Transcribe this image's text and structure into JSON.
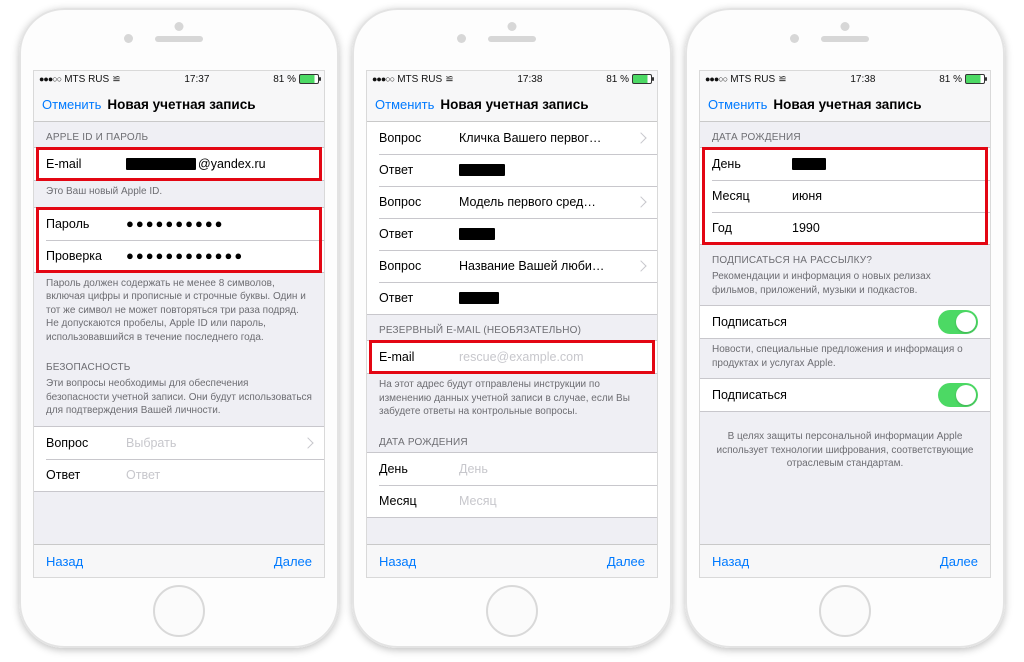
{
  "status": {
    "carrier": "MTS RUS",
    "time1": "17:37",
    "time2": "17:38",
    "time3": "17:38",
    "battery": "81 %"
  },
  "nav": {
    "cancel": "Отменить",
    "title": "Новая учетная запись"
  },
  "footer": {
    "back": "Назад",
    "next": "Далее"
  },
  "phone1": {
    "sec1_header": "APPLE ID И ПАРОЛЬ",
    "email_label": "E-mail",
    "email_value": "@yandex.ru",
    "sec1_footer": "Это Ваш новый Apple ID.",
    "password_label": "Пароль",
    "password_value": "●●●●●●●●●●",
    "verify_label": "Проверка",
    "verify_value": "●●●●●●●●●●●●",
    "sec2_footer": "Пароль должен содержать не менее 8 символов, включая цифры и прописные и строчные буквы. Один и тот же символ не может повторяться три раза подряд. Не допускаются пробелы, Apple ID или пароль, использовавшийся в течение последнего года.",
    "sec3_header": "БЕЗОПАСНОСТЬ",
    "sec3_footer": "Эти вопросы необходимы для обеспечения безопасности учетной записи. Они будут использоваться для подтверждения Вашей личности.",
    "question_label": "Вопрос",
    "question_placeholder": "Выбрать",
    "answer_label": "Ответ",
    "answer_placeholder": "Ответ"
  },
  "phone2": {
    "q_label": "Вопрос",
    "a_label": "Ответ",
    "q1": "Кличка Вашего первог…",
    "q2": "Модель первого сред…",
    "q3": "Название Вашей люби…",
    "backup_header": "РЕЗЕРВНЫЙ E-MAIL (НЕОБЯЗАТЕЛЬНО)",
    "backup_email_label": "E-mail",
    "backup_email_placeholder": "rescue@example.com",
    "backup_footer": "На этот адрес будут отправлены инструкции по изменению данных учетной записи в случае, если Вы забудете ответы на контрольные вопросы.",
    "dob_header": "ДАТА РОЖДЕНИЯ",
    "day_label": "День",
    "day_placeholder": "День",
    "month_label": "Месяц",
    "month_placeholder": "Месяц"
  },
  "phone3": {
    "dob_header": "ДАТА РОЖДЕНИЯ",
    "day_label": "День",
    "month_label": "Месяц",
    "month_value": "июня",
    "year_label": "Год",
    "year_value": "1990",
    "sub_header": "ПОДПИСАТЬСЯ НА РАССЫЛКУ?",
    "sub_footer1": "Рекомендации и информация о новых релизах фильмов, приложений, музыки и подкастов.",
    "sub_label": "Подписаться",
    "sub_footer2": "Новости, специальные предложения и информация о продуктах и услугах Apple.",
    "privacy_footer": "В целях защиты персональной информации Apple использует технологии шифрования, соответствующие отраслевым стандартам."
  }
}
